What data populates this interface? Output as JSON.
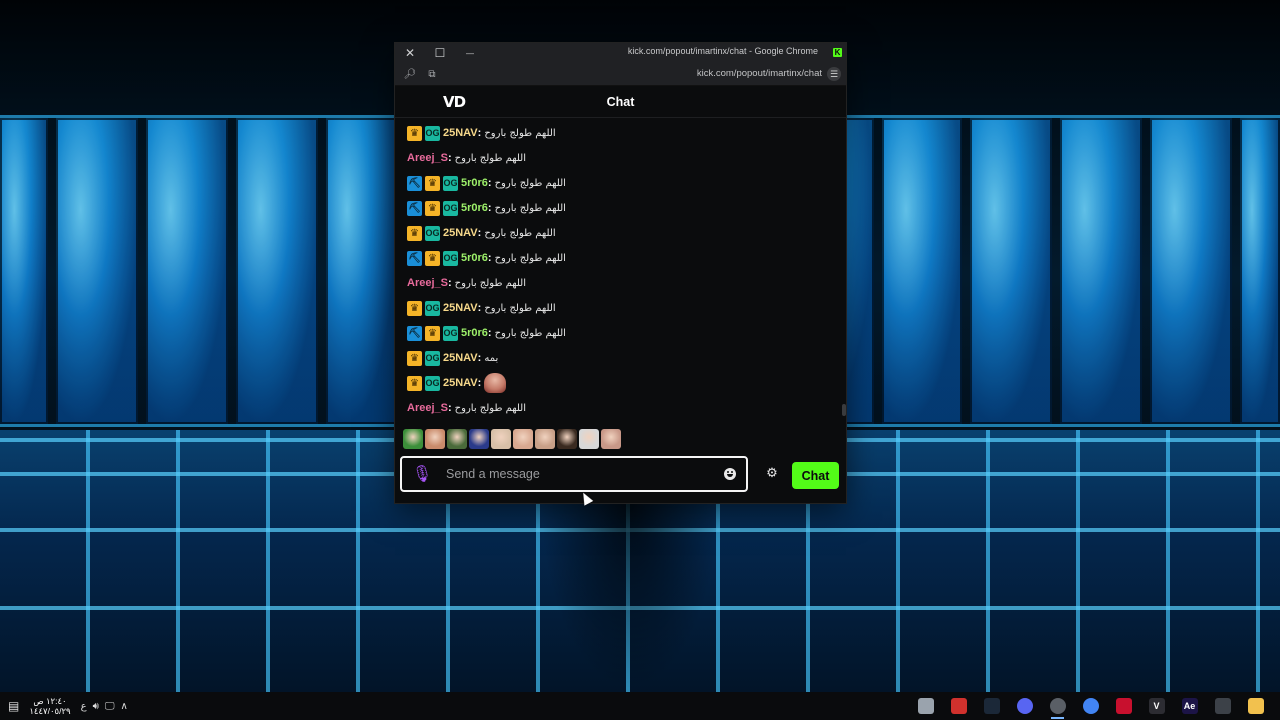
{
  "window": {
    "title": "kick.com/popout/imartinx/chat - Google Chrome",
    "url": "kick.com/popout/imartinx/chat",
    "controls": {
      "close": "✕",
      "maximize": "☐",
      "minimize": "—"
    }
  },
  "chat": {
    "header_title": "Chat",
    "channel_logo": "VD",
    "messages": [
      {
        "user": "25NAV",
        "color": "yellow",
        "badges": [
          "vip",
          "og"
        ],
        "text": "اللهم طولج باروح",
        "type": "text"
      },
      {
        "user": "Areej_S",
        "color": "pink",
        "badges": [],
        "text": "اللهم طولج باروح",
        "type": "text"
      },
      {
        "user": "5r0r6",
        "color": "green",
        "badges": [
          "mod",
          "vip",
          "og"
        ],
        "text": "اللهم طولج باروح",
        "type": "text"
      },
      {
        "user": "5r0r6",
        "color": "green",
        "badges": [
          "mod",
          "vip",
          "og"
        ],
        "text": "اللهم طولج باروح",
        "type": "text"
      },
      {
        "user": "25NAV",
        "color": "yellow",
        "badges": [
          "vip",
          "og"
        ],
        "text": "اللهم طولج باروح",
        "type": "text"
      },
      {
        "user": "5r0r6",
        "color": "green",
        "badges": [
          "mod",
          "vip",
          "og"
        ],
        "text": "اللهم طولج باروح",
        "type": "text"
      },
      {
        "user": "Areej_S",
        "color": "pink",
        "badges": [],
        "text": "اللهم طولج باروح",
        "type": "text"
      },
      {
        "user": "25NAV",
        "color": "yellow",
        "badges": [
          "vip",
          "og"
        ],
        "text": "اللهم طولج باروح",
        "type": "text"
      },
      {
        "user": "5r0r6",
        "color": "green",
        "badges": [
          "mod",
          "vip",
          "og"
        ],
        "text": "اللهم طولج باروح",
        "type": "text"
      },
      {
        "user": "25NAV",
        "color": "yellow",
        "badges": [
          "vip",
          "og"
        ],
        "text": "بمه",
        "type": "text"
      },
      {
        "user": "25NAV",
        "color": "yellow",
        "badges": [
          "vip",
          "og"
        ],
        "text": "",
        "type": "emote"
      },
      {
        "user": "Areej_S",
        "color": "pink",
        "badges": [],
        "text": "اللهم طولج باروح",
        "type": "text"
      }
    ],
    "colon": ":",
    "emote_bar_colors": [
      "#3c8f3a",
      "#c98b6b",
      "#4a6b3a",
      "#2a3a8a",
      "#d8c0a8",
      "#d8a890",
      "#c8a088",
      "#3a2a20",
      "#d8d8d8",
      "#c89888"
    ],
    "input_placeholder": "Send a message",
    "send_label": "Chat",
    "accent": "#53fc18"
  },
  "taskbar": {
    "time": "١٢:٤٠ ص",
    "date": "١٤٤٧/٠٥/٢٩",
    "lang": "ع",
    "apps": [
      {
        "name": "file-explorer",
        "color": "#f2c14e",
        "label": ""
      },
      {
        "name": "capcut",
        "color": "#c8102e",
        "label": ""
      },
      {
        "name": "chrome",
        "color": "#4285f4",
        "label": ""
      },
      {
        "name": "chrome-kick",
        "color": "#555a60",
        "label": ""
      },
      {
        "name": "discord",
        "color": "#5865f2",
        "label": ""
      },
      {
        "name": "steam",
        "color": "#1b2838",
        "label": ""
      },
      {
        "name": "record-app",
        "color": "#d0312d",
        "label": ""
      },
      {
        "name": "files",
        "color": "#6b7178",
        "label": ""
      }
    ],
    "app_labels": [
      "",
      "Ae",
      "V",
      "",
      "",
      "",
      "",
      "",
      "",
      ""
    ]
  }
}
